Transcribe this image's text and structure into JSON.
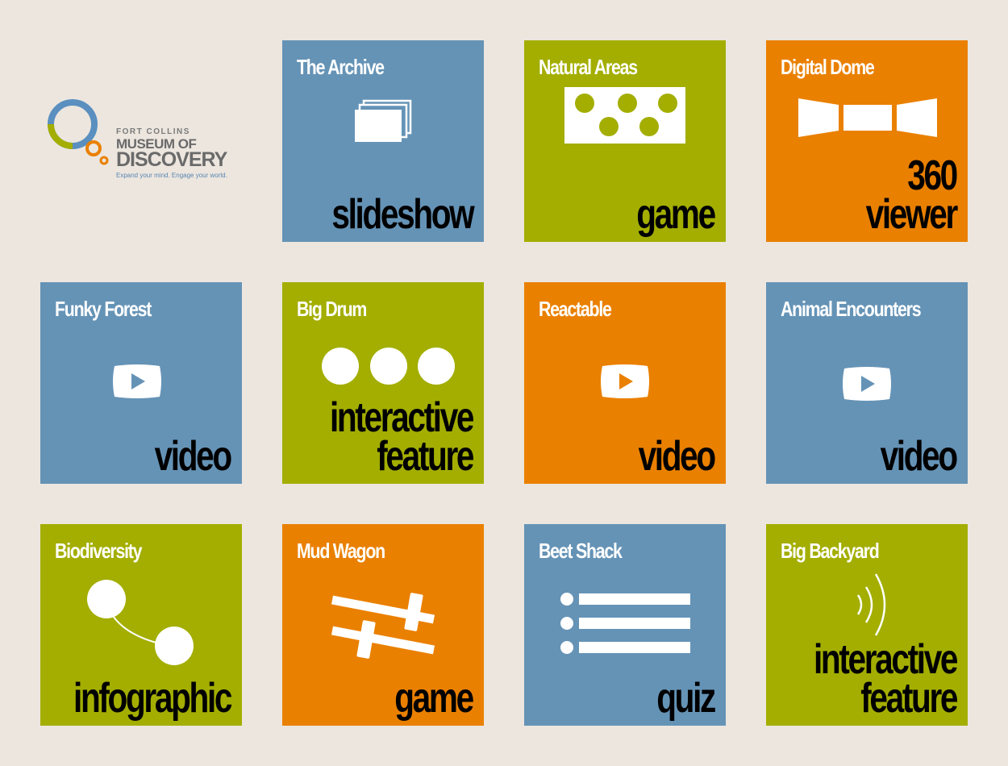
{
  "logo": {
    "line1": "FORT COLLINS",
    "line2": "MUSEUM OF",
    "line3": "DISCOVERY",
    "tagline": "Expand your mind. Engage your world."
  },
  "colors": {
    "blue": "#6593b6",
    "green": "#a3ae00",
    "orange": "#ea8000",
    "background": "#ece6df"
  },
  "tiles": [
    {
      "title": "The Archive",
      "type_line1": "slideshow",
      "type_line2": "",
      "icon": "slideshow-icon",
      "color": "blue"
    },
    {
      "title": "Natural Areas",
      "type_line1": "game",
      "type_line2": "",
      "icon": "dots-game-icon",
      "color": "green"
    },
    {
      "title": "Digital Dome",
      "type_line1": "360",
      "type_line2": "viewer",
      "icon": "panorama-icon",
      "color": "orange"
    },
    {
      "title": "Funky Forest",
      "type_line1": "video",
      "type_line2": "",
      "icon": "play-icon",
      "color": "blue"
    },
    {
      "title": "Big Drum",
      "type_line1": "interactive",
      "type_line2": "feature",
      "icon": "three-circles-icon",
      "color": "green"
    },
    {
      "title": "Reactable",
      "type_line1": "video",
      "type_line2": "",
      "icon": "play-icon",
      "color": "orange"
    },
    {
      "title": "Animal Encounters",
      "type_line1": "video",
      "type_line2": "",
      "icon": "play-icon",
      "color": "blue"
    },
    {
      "title": "Biodiversity",
      "type_line1": "infographic",
      "type_line2": "",
      "icon": "infographic-icon",
      "color": "green"
    },
    {
      "title": "Mud Wagon",
      "type_line1": "game",
      "type_line2": "",
      "icon": "sliders-game-icon",
      "color": "orange"
    },
    {
      "title": "Beet Shack",
      "type_line1": "quiz",
      "type_line2": "",
      "icon": "list-quiz-icon",
      "color": "blue"
    },
    {
      "title": "Big Backyard",
      "type_line1": "interactive",
      "type_line2": "feature",
      "icon": "sound-waves-icon",
      "color": "green"
    }
  ]
}
